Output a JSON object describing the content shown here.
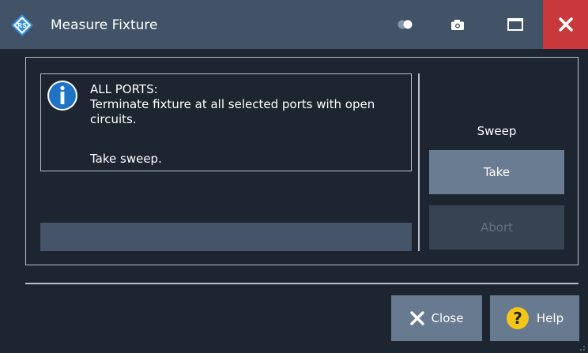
{
  "window": {
    "title": "Measure Fixture"
  },
  "titlebar_icons": {
    "logo": "rohde-schwarz-logo-icon",
    "toggle": "transparency-toggle-icon",
    "camera": "camera-icon",
    "maximize": "maximize-icon",
    "close": "close-icon"
  },
  "info": {
    "icon": "info-icon",
    "lines": [
      "ALL PORTS:",
      "Terminate fixture at all selected ports with open",
      "circuits.",
      "",
      "Take sweep."
    ]
  },
  "sweep": {
    "label": "Sweep",
    "take_label": "Take",
    "abort_label": "Abort",
    "abort_enabled": false
  },
  "footer": {
    "close_label": "Close",
    "help_label": "Help"
  },
  "colors": {
    "titlebar": "#425367",
    "background": "#1c2530",
    "button": "#687a8f",
    "button_disabled": "#364352",
    "close_red": "#c9383a",
    "info_blue": "#1f73c4",
    "help_yellow": "#f5c518"
  }
}
